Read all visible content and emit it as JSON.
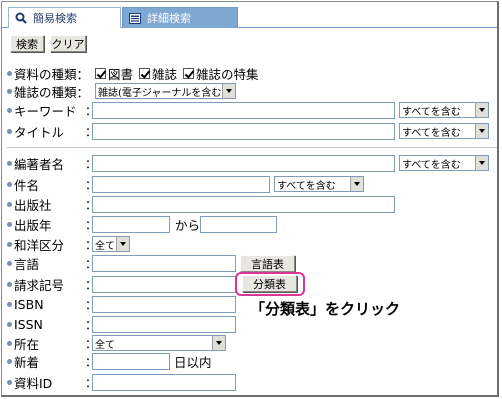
{
  "tabs": {
    "simple": "簡易検索",
    "detail": "詳細検索"
  },
  "toolbar": {
    "search": "検索",
    "clear": "クリア"
  },
  "colon": "：",
  "material_type": {
    "label": "資料の種類",
    "options": [
      {
        "label": "図書",
        "checked": true
      },
      {
        "label": "雑誌",
        "checked": true
      },
      {
        "label": "雑誌の特集",
        "checked": true
      }
    ]
  },
  "magazine_type": {
    "label": "雑誌の種類",
    "value": "雑誌(電子ジャーナルを含む)"
  },
  "keyword": {
    "label": "キーワード",
    "mode": "すべてを含む"
  },
  "title": {
    "label": "タイトル",
    "mode": "すべてを含む"
  },
  "author": {
    "label": "編著者名",
    "mode": "すべてを含む"
  },
  "subject": {
    "label": "件名",
    "mode": "すべてを含む"
  },
  "publisher": {
    "label": "出版社"
  },
  "pub_year": {
    "label": "出版年",
    "from_text": "から"
  },
  "lang_class": {
    "label": "和洋区分",
    "value": "全て"
  },
  "language": {
    "label": "言語",
    "button": "言語表"
  },
  "call_number": {
    "label": "請求記号",
    "button": "分類表"
  },
  "isbn": {
    "label": "ISBN"
  },
  "issn": {
    "label": "ISSN"
  },
  "location": {
    "label": "所在",
    "value": "全て"
  },
  "new_arrival": {
    "label": "新着",
    "suffix": "日以内"
  },
  "material_id": {
    "label": "資料ID"
  },
  "annotation": "「分類表」をクリック",
  "colors": {
    "tab_active": "#7ea7d1",
    "highlight": "#d9369d"
  }
}
